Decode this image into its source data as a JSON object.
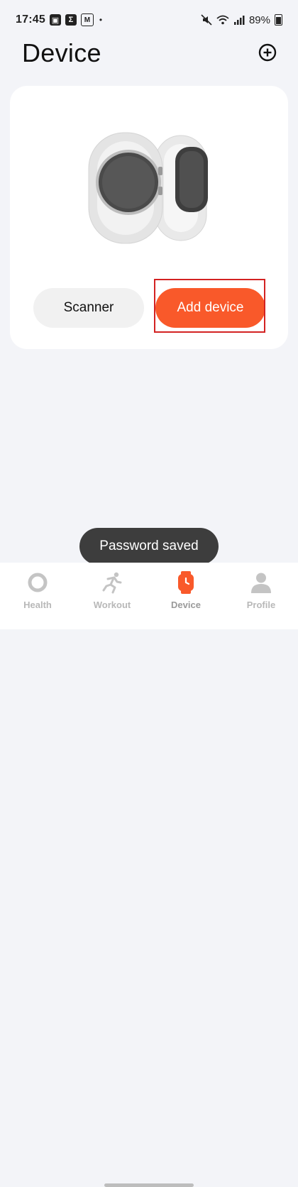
{
  "status_bar": {
    "time": "17:45",
    "dot": "•",
    "battery": "89%"
  },
  "header": {
    "title": "Device",
    "add_icon": "plus-circle-icon"
  },
  "card": {
    "illustration": "watch-and-band-illustration",
    "scanner_label": "Scanner",
    "add_device_label": "Add device"
  },
  "toast": {
    "text": "Password saved"
  },
  "bottom_nav": {
    "items": [
      {
        "label": "Health",
        "icon": "ring-icon",
        "active": false
      },
      {
        "label": "Workout",
        "icon": "runner-icon",
        "active": false
      },
      {
        "label": "Device",
        "icon": "watch-icon",
        "active": true
      },
      {
        "label": "Profile",
        "icon": "person-icon",
        "active": false
      }
    ]
  },
  "colors": {
    "accent": "#f9592a",
    "background": "#f3f4f8",
    "highlight": "#d32222"
  }
}
